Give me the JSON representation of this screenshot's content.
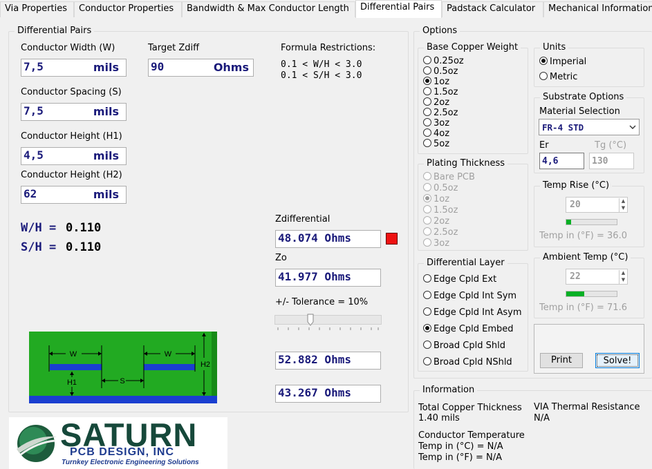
{
  "tabs": [
    "Via Properties",
    "Conductor Properties",
    "Bandwidth & Max Conductor Length",
    "Differential Pairs",
    "Padstack Calculator",
    "Mechanical Information"
  ],
  "active_tab": "Differential Pairs",
  "diff_pairs": {
    "title": "Differential Pairs",
    "conductor_width": {
      "label": "Conductor Width (W)",
      "value": "7,5",
      "unit": "mils"
    },
    "target_zdiff": {
      "label": "Target Zdiff",
      "value": "90",
      "unit": "Ohms"
    },
    "formula_title": "Formula Restrictions:",
    "formula_1": "0.1 < W/H < 3.0",
    "formula_2": "0.1 < S/H < 3.0",
    "conductor_spacing": {
      "label": "Conductor Spacing (S)",
      "value": "7,5",
      "unit": "mils"
    },
    "conductor_h1": {
      "label": "Conductor Height (H1)",
      "value": "4,5",
      "unit": "mils"
    },
    "conductor_h2": {
      "label": "Conductor Height (H2)",
      "value": "62",
      "unit": "mils"
    },
    "wh_label": "W/H =",
    "wh_value": "0.110",
    "sh_label": "S/H =",
    "sh_value": "0.110",
    "zdiff_label": "Zdifferential",
    "zdiff_value": "48.074 Ohms",
    "zo_label": "Zo",
    "zo_value": "41.977 Ohms",
    "tolerance_label": "+/- Tolerance = 10%",
    "tolerance_high": "52.882 Ohms",
    "tolerance_low": "43.267 Ohms",
    "status_color": "#ee1111",
    "diagram_labels": {
      "w": "W",
      "s": "S",
      "h1": "H1",
      "h2": "H2"
    }
  },
  "logo": {
    "name": "SATURN",
    "sub": "PCB DESIGN, INC",
    "tagline": "Turnkey Electronic Engineering Solutions"
  },
  "options": {
    "title": "Options",
    "copper": {
      "title": "Base Copper Weight",
      "items": [
        "0.25oz",
        "0.5oz",
        "1oz",
        "1.5oz",
        "2oz",
        "2.5oz",
        "3oz",
        "4oz",
        "5oz"
      ],
      "selected": "1oz"
    },
    "plating": {
      "title": "Plating Thickness",
      "items": [
        "Bare PCB",
        "0.5oz",
        "1oz",
        "1.5oz",
        "2oz",
        "2.5oz",
        "3oz"
      ],
      "selected": "1oz"
    },
    "layer": {
      "title": "Differential Layer",
      "items": [
        "Edge Cpld Ext",
        "Edge Cpld Int Sym",
        "Edge Cpld Int Asym",
        "Edge Cpld Embed",
        "Broad Cpld Shld",
        "Broad Cpld NShld"
      ],
      "selected": "Edge Cpld Embed"
    },
    "units": {
      "title": "Units",
      "items": [
        "Imperial",
        "Metric"
      ],
      "selected": "Imperial"
    },
    "substrate": {
      "title": "Substrate Options",
      "material_label": "Material Selection",
      "material_value": "FR-4 STD",
      "er_label": "Er",
      "er_value": "4,6",
      "tg_label": "Tg (°C)",
      "tg_value": "130"
    },
    "temp_rise": {
      "title": "Temp Rise (°C)",
      "value": "20",
      "fahrenheit": "Temp in (°F) = 36.0",
      "level": 0.1
    },
    "ambient": {
      "title": "Ambient Temp (°C)",
      "value": "22",
      "fahrenheit": "Temp in (°F) = 71.6",
      "level": 0.35
    },
    "print_label": "Print",
    "solve_label": "Solve!"
  },
  "info": {
    "title": "Information",
    "copper_label": "Total Copper Thickness",
    "copper_value": "1.40 mils",
    "via_label": "VIA Thermal Resistance",
    "via_value": "N/A",
    "temp_label": "Conductor Temperature",
    "temp_c": "Temp in (°C) = N/A",
    "temp_f": "Temp in (°F) = N/A"
  }
}
